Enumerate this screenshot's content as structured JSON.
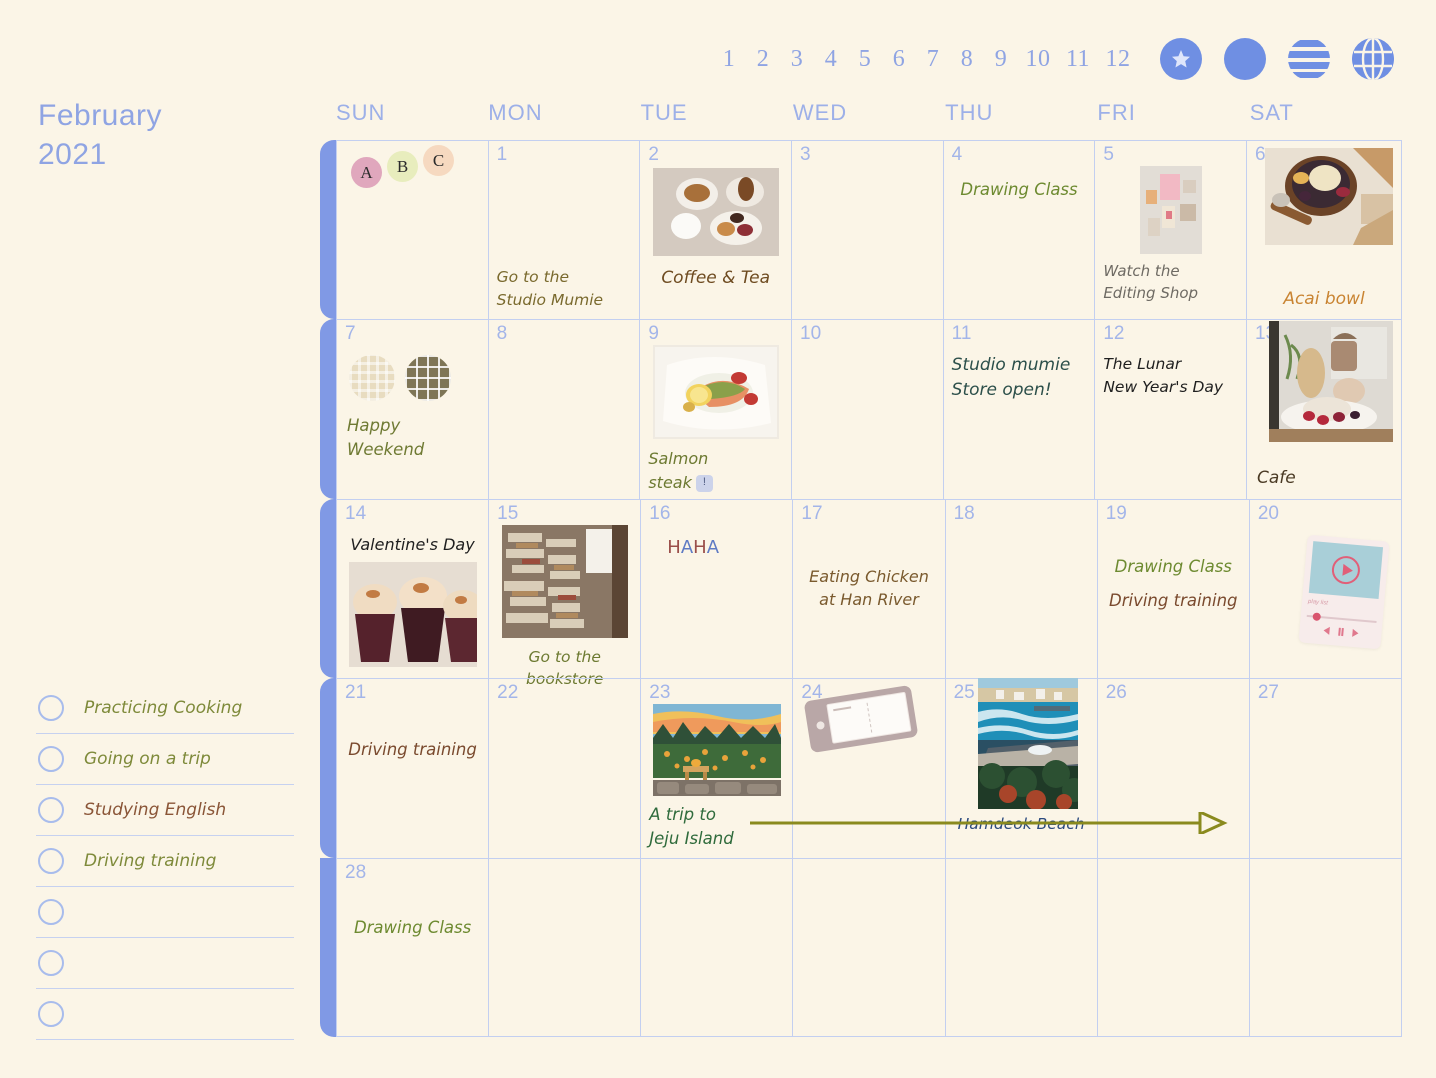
{
  "header": {
    "month_name": "February",
    "year": "2021",
    "month_numbers": [
      "1",
      "2",
      "3",
      "4",
      "5",
      "6",
      "7",
      "8",
      "9",
      "10",
      "11",
      "12"
    ],
    "icons": [
      {
        "name": "star-badge-icon",
        "label": "star"
      },
      {
        "name": "solid-circle-icon",
        "label": "circle"
      },
      {
        "name": "striped-circle-icon",
        "label": "stripes"
      },
      {
        "name": "globe-icon",
        "label": "globe"
      }
    ]
  },
  "weekdays": [
    "SUN",
    "MON",
    "TUE",
    "WED",
    "THU",
    "FRI",
    "SAT"
  ],
  "checklist": {
    "items": [
      {
        "label": "Practicing Cooking",
        "color": "#7e8a3a",
        "checked": false
      },
      {
        "label": "Going on a trip",
        "color": "#7e8a3a",
        "checked": false
      },
      {
        "label": "Studying English",
        "color": "#8a5537",
        "checked": false
      },
      {
        "label": "Driving training",
        "color": "#7e8a3a",
        "checked": false
      },
      {
        "label": "",
        "color": "#7e8a3a",
        "checked": false
      },
      {
        "label": "",
        "color": "#7e8a3a",
        "checked": false
      },
      {
        "label": "",
        "color": "#7e8a3a",
        "checked": false
      }
    ]
  },
  "colors": {
    "page_background": "#fbf5e7",
    "accent_blue": "#8099e5",
    "grid_line": "#c3cff0",
    "daynum": "#a3b5e9",
    "weekday": "#9db0e8",
    "olive_green": "#7e8a3a",
    "brown": "#7a5a2e",
    "dark_green": "#2f6b3c",
    "navy": "#2b4a7e",
    "teal": "#2c4f4a",
    "black_text": "#1f1f1f",
    "gray_text": "#6e6a63",
    "orange": "#c98432",
    "arrow_olive": "#8a8a1e"
  },
  "trip_arrow": {
    "from_day": "23",
    "to_day": "26",
    "color": "#8a8a1e"
  },
  "stickers": {
    "abc": [
      {
        "letter": "A",
        "color": "#e0a7bd"
      },
      {
        "letter": "B",
        "color": "#e8edbd"
      },
      {
        "letter": "C",
        "color": "#f6d9c0"
      }
    ],
    "texture_circles": [
      "light-waffle",
      "dark-cross"
    ],
    "note_tag_day": "24",
    "music_player_day": "20",
    "music_player_label": "play list"
  },
  "weeks": [
    [
      {
        "day": "",
        "events": [],
        "sticker": "abc"
      },
      {
        "day": "1",
        "events": [
          {
            "text": "Go to the\nStudio Mumie",
            "color": "#7a6a2e",
            "align": "left",
            "pos": "bottom"
          }
        ]
      },
      {
        "day": "2",
        "photo": "coffee-and-tea",
        "events": [
          {
            "text": "Coffee & Tea",
            "color": "#6e4b20",
            "align": "center",
            "pos": "photo"
          }
        ]
      },
      {
        "day": "3",
        "events": []
      },
      {
        "day": "4",
        "events": [
          {
            "text": "Drawing Class",
            "color": "#6d8a30",
            "align": "center",
            "pos": "top"
          }
        ]
      },
      {
        "day": "5",
        "photo": "editing-shop",
        "events": [
          {
            "text": "Watch the\nEditing Shop",
            "color": "#6e6a63",
            "align": "left",
            "pos": "photo"
          }
        ]
      },
      {
        "day": "6",
        "photo": "acai-bowl",
        "events": [
          {
            "text": "Acai bowl",
            "color": "#c98432",
            "align": "center",
            "pos": "photo"
          }
        ]
      }
    ],
    [
      {
        "day": "7",
        "sticker": "texture",
        "events": [
          {
            "text": "Happy Weekend",
            "color": "#6f7a33",
            "align": "left",
            "pos": "sticker"
          }
        ]
      },
      {
        "day": "8",
        "events": []
      },
      {
        "day": "9",
        "photo": "salmon-steak",
        "events": [
          {
            "text": "Salmon\nsteak",
            "color": "#6d7a32",
            "align": "left",
            "pos": "photo",
            "badge": "!"
          }
        ]
      },
      {
        "day": "10",
        "events": []
      },
      {
        "day": "11",
        "events": [
          {
            "text": "Studio mumie\nStore open!",
            "color": "#2c4f4a",
            "align": "left",
            "pos": "top"
          }
        ]
      },
      {
        "day": "12",
        "events": [
          {
            "text": "The Lunar\nNew Year's Day",
            "color": "#1f1f1f",
            "align": "left",
            "pos": "top"
          }
        ]
      },
      {
        "day": "13",
        "photo": "cafe-dessert",
        "events": [
          {
            "text": "Cafe",
            "color": "#4a3a24",
            "align": "left",
            "pos": "photo"
          }
        ]
      }
    ],
    [
      {
        "day": "14",
        "photo": "cupcakes",
        "events": [
          {
            "text": "Valentine's Day",
            "color": "#1f1f1f",
            "align": "center",
            "pos": "top"
          }
        ]
      },
      {
        "day": "15",
        "photo": "bookstore",
        "events": [
          {
            "text": "Go to the bookstore",
            "color": "#6d7a32",
            "align": "center",
            "pos": "photo"
          }
        ]
      },
      {
        "day": "16",
        "events": [
          {
            "text": "HAHA",
            "color": "multi",
            "align": "left",
            "pos": "top"
          }
        ]
      },
      {
        "day": "17",
        "events": [
          {
            "text": "Eating Chicken\nat Han River",
            "color": "#7a5a2e",
            "align": "center",
            "pos": "mid"
          }
        ]
      },
      {
        "day": "18",
        "events": []
      },
      {
        "day": "19",
        "events": [
          {
            "text": "Drawing Class",
            "color": "#6d8a30",
            "align": "center",
            "pos": "mid"
          },
          {
            "text": "Driving training",
            "color": "#7a4a2e",
            "align": "center",
            "pos": "mid"
          }
        ]
      },
      {
        "day": "20",
        "sticker": "player",
        "events": []
      }
    ],
    [
      {
        "day": "21",
        "events": [
          {
            "text": "Driving training",
            "color": "#7a4a2e",
            "align": "center",
            "pos": "mid"
          }
        ]
      },
      {
        "day": "22",
        "events": []
      },
      {
        "day": "23",
        "photo": "jeju-field",
        "events": [
          {
            "text": "A trip to\nJeju Island",
            "color": "#2f6b3c",
            "align": "left",
            "pos": "photo"
          }
        ]
      },
      {
        "day": "24",
        "sticker": "tag",
        "events": []
      },
      {
        "day": "25",
        "photo": "hamdeok-beach",
        "events": [
          {
            "text": "Hamdeok Beach",
            "color": "#2b4a7e",
            "align": "center",
            "pos": "photo"
          }
        ]
      },
      {
        "day": "26",
        "events": []
      },
      {
        "day": "27",
        "events": []
      }
    ],
    [
      {
        "day": "28",
        "events": [
          {
            "text": "Drawing Class",
            "color": "#6d8a30",
            "align": "center",
            "pos": "mid"
          }
        ]
      },
      {
        "day": "",
        "events": []
      },
      {
        "day": "",
        "events": []
      },
      {
        "day": "",
        "events": []
      },
      {
        "day": "",
        "events": []
      },
      {
        "day": "",
        "events": []
      },
      {
        "day": "",
        "events": []
      }
    ]
  ]
}
